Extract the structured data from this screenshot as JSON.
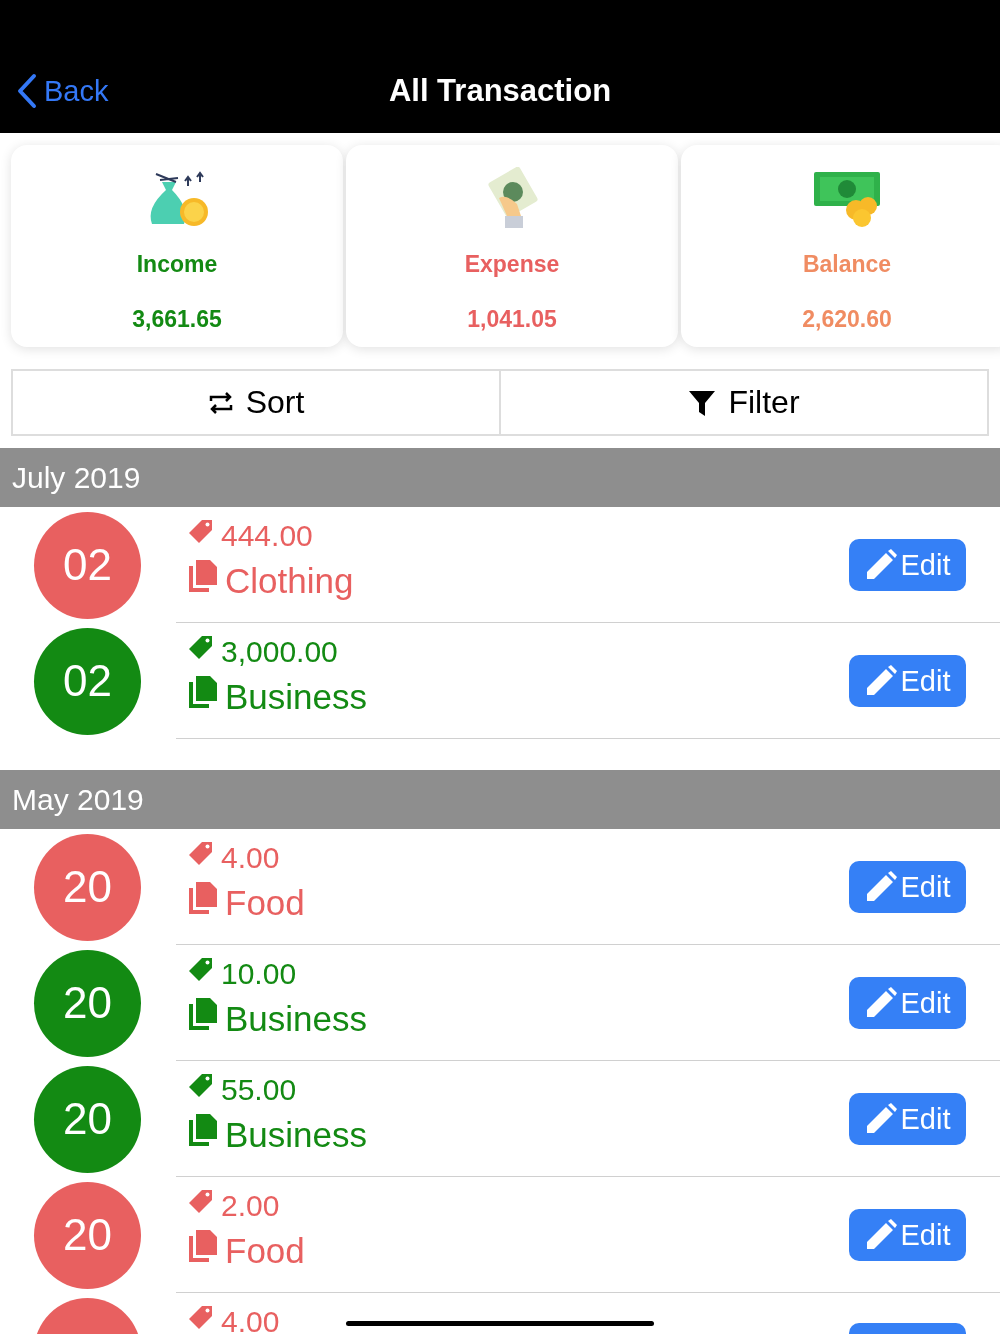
{
  "nav": {
    "back": "Back",
    "title": "All Transaction"
  },
  "summary": [
    {
      "kind": "income",
      "label": "Income",
      "amount": "3,661.65"
    },
    {
      "kind": "expense",
      "label": "Expense",
      "amount": "1,041.05"
    },
    {
      "kind": "balance",
      "label": "Balance",
      "amount": "2,620.60"
    }
  ],
  "toolbar": {
    "sort": "Sort",
    "filter": "Filter"
  },
  "sections": [
    {
      "title": "July 2019",
      "rows": [
        {
          "kind": "expense",
          "day": "02",
          "amount": "444.00",
          "category": "Clothing",
          "edit": "Edit"
        },
        {
          "kind": "income",
          "day": "02",
          "amount": "3,000.00",
          "category": "Business",
          "edit": "Edit"
        }
      ]
    },
    {
      "title": "May 2019",
      "rows": [
        {
          "kind": "expense",
          "day": "20",
          "amount": "4.00",
          "category": "Food",
          "edit": "Edit"
        },
        {
          "kind": "income",
          "day": "20",
          "amount": "10.00",
          "category": "Business",
          "edit": "Edit"
        },
        {
          "kind": "income",
          "day": "20",
          "amount": "55.00",
          "category": "Business",
          "edit": "Edit"
        },
        {
          "kind": "expense",
          "day": "20",
          "amount": "2.00",
          "category": "Food",
          "edit": "Edit"
        },
        {
          "kind": "expense",
          "amount": "4.00"
        }
      ]
    }
  ]
}
